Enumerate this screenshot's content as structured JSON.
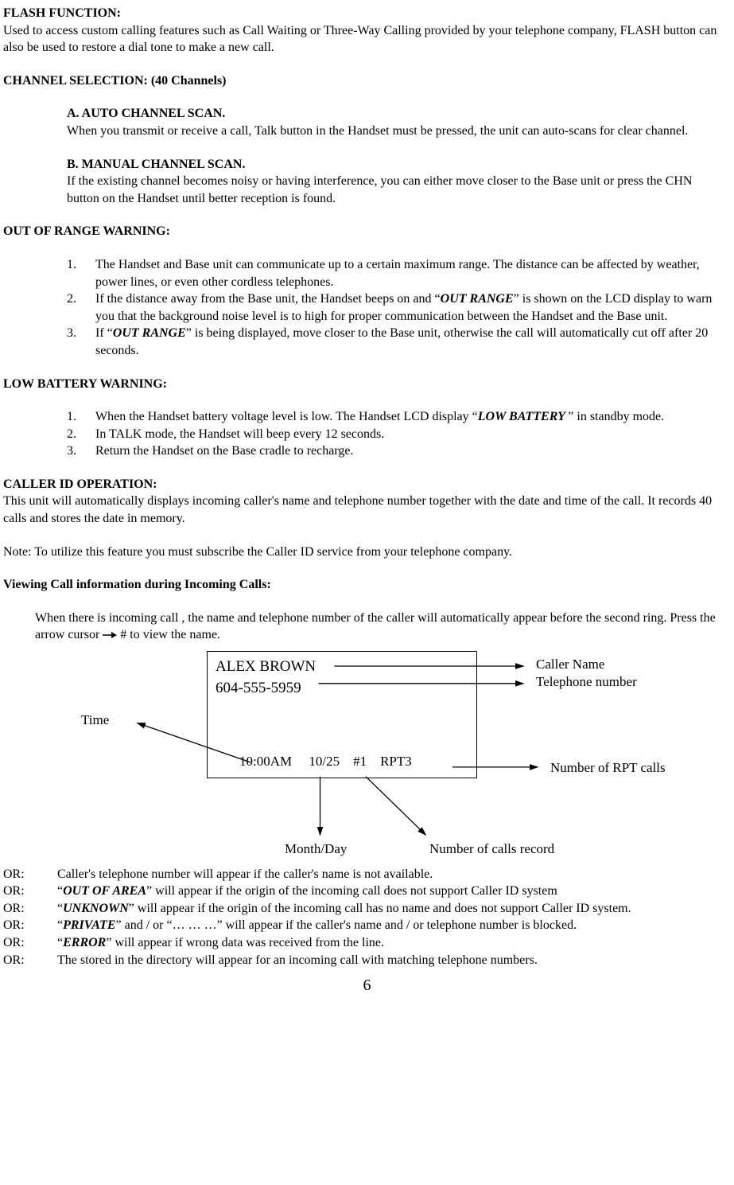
{
  "flash": {
    "heading": "FLASH FUNCTION:",
    "body": "Used to access custom calling features such as Call Waiting or Three-Way Calling provided by your telephone company, FLASH button can also be used to restore a dial tone to make a new call."
  },
  "channel": {
    "heading": "CHANNEL SELECTION:  (40 Channels)",
    "a_label": "A.    AUTO CHANNEL SCAN.",
    "a_body": "When you transmit or receive a call, Talk button in the Handset must be pressed, the unit can auto-scans for clear channel.",
    "b_label": "B.     MANUAL CHANNEL SCAN.",
    "b_body": "If the existing channel becomes noisy or having interference, you can either move closer to the Base unit or press the CHN button on the Handset until better reception is found."
  },
  "outrange": {
    "heading": "OUT OF RANGE WARNING:",
    "items": {
      "n1": "1.",
      "t1": "The Handset and Base unit can communicate up to a certain maximum range. The distance can be affected by weather, power lines, or even other cordless telephones.",
      "n2": "2.",
      "t2a": "If the distance away from the Base unit, the Handset beeps on and “",
      "t2b": "OUT RANGE",
      "t2c": "” is shown on the LCD display to warn you that the background noise level is to high for proper communication between the Handset and the Base unit.",
      "n3": "3.",
      "t3a": "If “",
      "t3b": "OUT RANGE",
      "t3c": "” is being displayed, move closer to the Base unit, otherwise the call will automatically cut off after 20 seconds."
    }
  },
  "lowbatt": {
    "heading": "LOW BATTERY WARNING:",
    "items": {
      "n1": "1.",
      "t1a": "When the Handset battery voltage level is low. The Handset LCD display “",
      "t1b": "LOW BATTERY ",
      "t1c": "” in standby mode.",
      "n2": "2.",
      "t2": "In TALK mode, the Handset will beep every 12 seconds.",
      "n3": "3.",
      "t3": "Return the Handset on the Base cradle to recharge."
    }
  },
  "cid": {
    "heading": "CALLER ID OPERATION:",
    "body": "This unit will automatically displays incoming caller's name and telephone number together with the date and time of the call. It records 40 calls and stores the date in memory.",
    "note": "Note:     To utilize this feature you must subscribe the Caller ID service from your  telephone company.",
    "view_heading": "Viewing Call information during Incoming Calls:",
    "view_body_a": "When there is incoming call , the name and telephone number  of the caller will automatically appear before the second ring. Press the arrow cursor",
    "view_body_b": "#  to view the name."
  },
  "diagram": {
    "name": "ALEX BROWN",
    "phone": "604-555-5959",
    "status": "10:00AM     10/25    #1    RPT3",
    "labels": {
      "caller_name": "Caller Name",
      "telephone_number": "Telephone number",
      "time": "Time",
      "number_rpt": "Number of RPT calls",
      "month_day": "Month/Day",
      "number_calls_record": "Number of calls record"
    }
  },
  "ors": {
    "lbl": "OR:",
    "r1": " Caller's telephone number will appear if the caller's name is not available.",
    "r2a": "“",
    "r2b": "OUT OF AREA",
    "r2c": "” will appear if the origin of the incoming call does not support Caller ID system",
    "r3a": "“",
    "r3b": "UNKNOWN",
    "r3c": "” will appear if the origin of the incoming call has no name and does not support Caller ID system.",
    "r4a": "“",
    "r4b": "PRIVATE",
    "r4c": "” and  / or “…  …  …” will appear if the caller's name and / or telephone number is blocked.",
    "r5a": "“",
    "r5b": "ERROR",
    "r5c": "” will appear if wrong data was received from the line.",
    "r6": " The stored in the directory will appear for an incoming call with matching telephone numbers."
  },
  "page_number": "6"
}
